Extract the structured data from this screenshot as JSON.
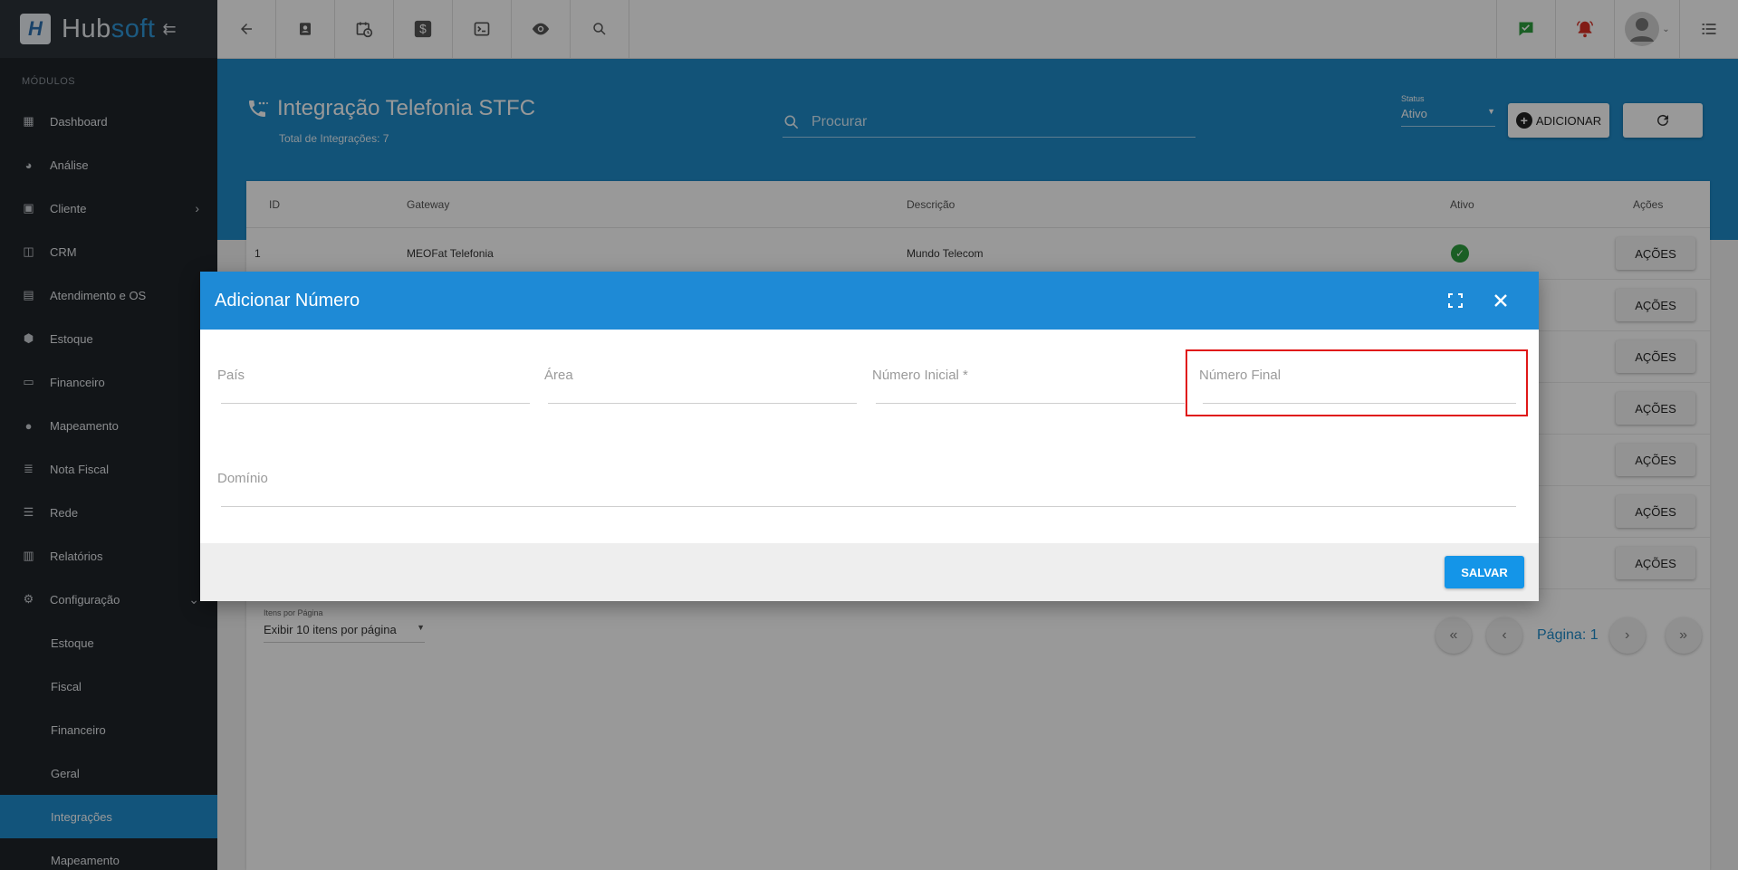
{
  "app": {
    "brand_left": "Hub",
    "brand_right": "soft"
  },
  "sidebar": {
    "section_label": "MÓDULOS",
    "items": [
      {
        "label": "Dashboard"
      },
      {
        "label": "Análise"
      },
      {
        "label": "Cliente"
      },
      {
        "label": "CRM"
      },
      {
        "label": "Atendimento e OS"
      },
      {
        "label": "Estoque"
      },
      {
        "label": "Financeiro"
      },
      {
        "label": "Mapeamento"
      },
      {
        "label": "Nota Fiscal"
      },
      {
        "label": "Rede"
      },
      {
        "label": "Relatórios"
      },
      {
        "label": "Configuração"
      }
    ],
    "sub_items": [
      {
        "label": "Estoque"
      },
      {
        "label": "Fiscal"
      },
      {
        "label": "Financeiro"
      },
      {
        "label": "Geral"
      },
      {
        "label": "Integrações"
      },
      {
        "label": "Mapeamento"
      }
    ]
  },
  "header": {
    "title": "Integração Telefonia STFC",
    "subtitle": "Total de Integrações: 7",
    "search_placeholder": "Procurar",
    "status_label": "Status",
    "status_value": "Ativo",
    "add_label": "ADICIONAR"
  },
  "table": {
    "columns": [
      "ID",
      "Gateway",
      "Descrição",
      "Ativo",
      "Ações"
    ],
    "first_row": {
      "id": "1",
      "gateway": "MEOFat Telefonia",
      "descricao": "Mundo Telecom"
    },
    "action_label": "AÇÕES"
  },
  "pagination": {
    "per_page_label": "Itens por Página",
    "per_page_value": "Exibir 10 itens por página",
    "page_label": "Página: 1"
  },
  "modal": {
    "title": "Adicionar Número",
    "fields": {
      "pais": "País",
      "area": "Área",
      "numero_inicial": "Número Inicial *",
      "numero_final": "Número Final",
      "dominio": "Domínio"
    },
    "save_label": "SALVAR"
  },
  "colors": {
    "primary": "#1e8ac8",
    "modal_header": "#1e8ad6",
    "sidebar": "#1f2329",
    "highlight": "#e01818"
  }
}
